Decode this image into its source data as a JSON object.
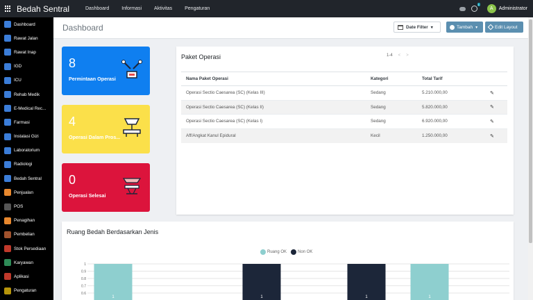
{
  "header": {
    "brand": "Bedah Sentral",
    "nav": [
      "Dashboard",
      "Informasi",
      "Aktivitas",
      "Pengaturan"
    ],
    "activity_badge": "1",
    "avatar_letter": "A",
    "user": "Administrator"
  },
  "sidebar": {
    "items": [
      {
        "label": "Dashboard",
        "color": "#3b7dd8"
      },
      {
        "label": "Rawat Jalan",
        "color": "#3b7dd8"
      },
      {
        "label": "Rawat Inap",
        "color": "#3b7dd8"
      },
      {
        "label": "IGD",
        "color": "#3b7dd8"
      },
      {
        "label": "ICU",
        "color": "#3b7dd8"
      },
      {
        "label": "Rehab Medik",
        "color": "#3b7dd8"
      },
      {
        "label": "E-Medical Rec...",
        "color": "#3b7dd8"
      },
      {
        "label": "Farmasi",
        "color": "#3b7dd8"
      },
      {
        "label": "Instalasi Gizi",
        "color": "#3b7dd8"
      },
      {
        "label": "Laboratorium",
        "color": "#3b7dd8"
      },
      {
        "label": "Radiologi",
        "color": "#3b7dd8"
      },
      {
        "label": "Bedah Sentral",
        "color": "#3b7dd8"
      },
      {
        "label": "Penjualan",
        "color": "#e8882e"
      },
      {
        "label": "POS",
        "color": "#555555"
      },
      {
        "label": "Penagihan",
        "color": "#e8882e"
      },
      {
        "label": "Pembelian",
        "color": "#a0522d"
      },
      {
        "label": "Stok Persediaan",
        "color": "#c0392b"
      },
      {
        "label": "Karyawan",
        "color": "#2e8b57"
      },
      {
        "label": "Aplikasi",
        "color": "#c0392b"
      },
      {
        "label": "Pengaturan",
        "color": "#b7950b"
      }
    ]
  },
  "toolbar": {
    "title": "Dashboard",
    "date_filter": "Date Filter",
    "add": "Tambah",
    "edit_layout": "Edit Layout"
  },
  "cards": [
    {
      "value": "8",
      "label": "Permintaan Operasi",
      "color": "#0f7ff0"
    },
    {
      "value": "4",
      "label": "Operasi Dalam Pros...",
      "color": "#fbe04a"
    },
    {
      "value": "0",
      "label": "Operasi Selesai",
      "color": "#dc143c"
    }
  ],
  "paket": {
    "title": "Paket Operasi",
    "pager": "1-4",
    "headers": [
      "Nama Paket Operasi",
      "Kategori",
      "Total Tarif"
    ],
    "rows": [
      {
        "nama": "Operasi Sectio Caesarea (SC) (Kelas III)",
        "kategori": "Sedang",
        "tarif": "5.210.000,00"
      },
      {
        "nama": "Operasi Sectio Caesarea (SC) (Kelas II)",
        "kategori": "Sedang",
        "tarif": "5.820.000,00"
      },
      {
        "nama": "Operasi Sectio Caesarea (SC) (Kelas I)",
        "kategori": "Sedang",
        "tarif": "6.920.000,00"
      },
      {
        "nama": "Aff/Angkat Kanul Epidural",
        "kategori": "Kecil",
        "tarif": "1.250.000,00"
      }
    ]
  },
  "chart_data": {
    "type": "bar",
    "title": "Ruang Bedah Berdasarkan Jenis",
    "legend": [
      {
        "name": "Ruang OK",
        "color": "#8ecfcf"
      },
      {
        "name": "Non OK",
        "color": "#1c2639"
      }
    ],
    "yticks": [
      "1",
      "0.9",
      "0.8",
      "0.7",
      "0.6"
    ],
    "bars": [
      {
        "series": "Ruang OK",
        "value": 1,
        "label": "1"
      },
      {
        "series": "Non OK",
        "value": 1,
        "label": "1"
      },
      {
        "series": "Non OK",
        "value": 1,
        "label": "1"
      },
      {
        "series": "Ruang OK",
        "value": 1,
        "label": "1"
      }
    ]
  }
}
